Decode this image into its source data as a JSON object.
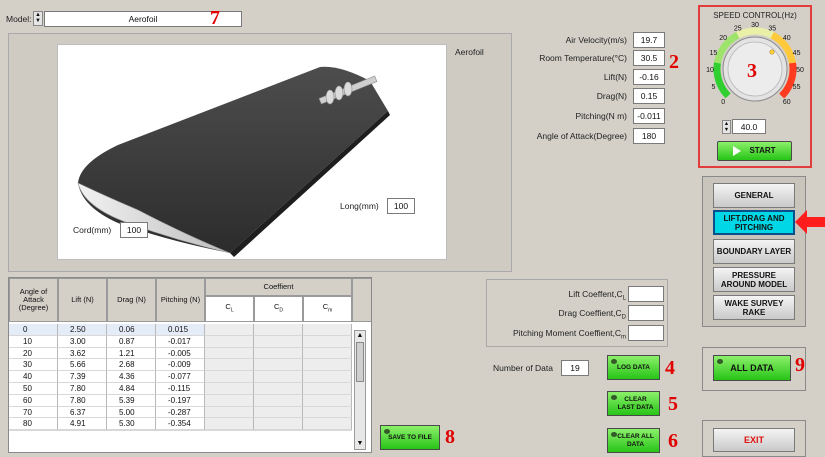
{
  "model": {
    "label": "Model:",
    "value": "Aerofoil"
  },
  "image_caption": "Aerofoil",
  "dimensions": {
    "cord_label": "Cord(mm)",
    "cord_value": "100",
    "long_label": "Long(mm)",
    "long_value": "100"
  },
  "readouts": [
    {
      "label": "Air Velocity(m/s)",
      "value": "19.7"
    },
    {
      "label": "Room Temperature(°C)",
      "value": "30.5"
    },
    {
      "label": "Lift(N)",
      "value": "-0.16"
    },
    {
      "label": "Drag(N)",
      "value": "0.15"
    },
    {
      "label": "Pitching(N m)",
      "value": "-0.011"
    },
    {
      "label": "Angle of Attack(Degree)",
      "value": "180"
    }
  ],
  "speed": {
    "title": "SPEED CONTROL(Hz)",
    "ticks": [
      "0",
      "5",
      "10",
      "15",
      "20",
      "25",
      "30",
      "35",
      "40",
      "45",
      "50",
      "55",
      "60"
    ],
    "value": "40.0",
    "level": 40,
    "start_label": "START"
  },
  "nav": [
    "GENERAL",
    "LIFT,DRAG AND PITCHING",
    "BOUNDARY LAYER",
    "PRESSURE AROUND MODEL",
    "WAKE SURVEY RAKE"
  ],
  "table": {
    "headers": {
      "angle": "Angle of Attack (Degree)",
      "lift": "Lift (N)",
      "drag": "Drag (N)",
      "pitching": "Pitching (N)",
      "coefficient": "Coeffient",
      "cl": "C",
      "cl_sub": "L",
      "cd": "C",
      "cd_sub": "D",
      "cm": "C",
      "cm_sub": "m"
    },
    "rows": [
      [
        "0",
        "2.50",
        "0.06",
        "0.015"
      ],
      [
        "10",
        "3.00",
        "0.87",
        "-0.017"
      ],
      [
        "20",
        "3.62",
        "1.21",
        "-0.005"
      ],
      [
        "30",
        "5.66",
        "2.68",
        "-0.009"
      ],
      [
        "40",
        "7.39",
        "4.36",
        "-0.077"
      ],
      [
        "50",
        "7.80",
        "4.84",
        "-0.115"
      ],
      [
        "60",
        "7.80",
        "5.39",
        "-0.197"
      ],
      [
        "70",
        "6.37",
        "5.00",
        "-0.287"
      ],
      [
        "80",
        "4.91",
        "5.30",
        "-0.354"
      ]
    ]
  },
  "coefficients": [
    {
      "label": "Lift Coeffent,C",
      "sub": "L",
      "value": ""
    },
    {
      "label": "Drag Coeffient,C",
      "sub": "D",
      "value": ""
    },
    {
      "label": "Pitching Moment Coeffient,C",
      "sub": "m",
      "value": ""
    }
  ],
  "num_data": {
    "label": "Number of Data",
    "value": "19"
  },
  "buttons": {
    "log_data": "LOG DATA",
    "clear_last": "CLEAR LAST DATA",
    "clear_all": "CLEAR ALL DATA",
    "save": "SAVE TO FILE",
    "all_data": "ALL DATA",
    "exit": "EXIT"
  },
  "annotations": [
    "2",
    "3",
    "4",
    "5",
    "6",
    "7",
    "8",
    "9"
  ],
  "colors": {
    "green": "#27c417",
    "annotation_red": "#e00000",
    "active_nav": "#00d7e6"
  }
}
